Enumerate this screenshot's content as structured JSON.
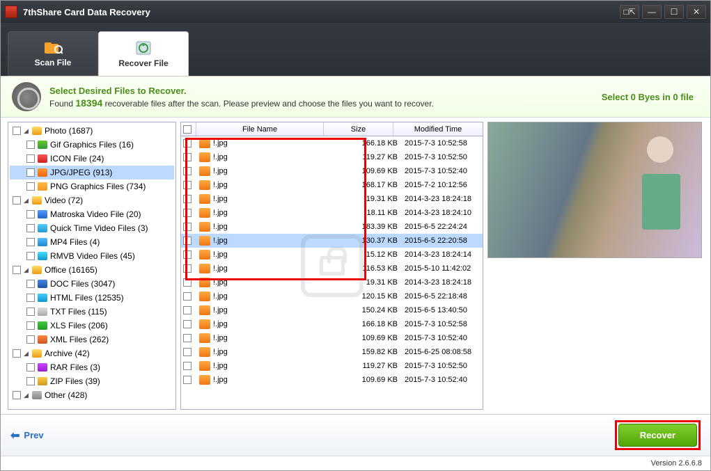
{
  "title": "7thShare Card Data Recovery",
  "tabs": {
    "scan": "Scan File",
    "recover": "Recover File"
  },
  "banner": {
    "title": "Select Desired Files to Recover.",
    "found_prefix": "Found ",
    "found_count": "18394",
    "found_suffix": " recoverable files after the scan. Please preview and choose the files you want to recover.",
    "select_status": "Select 0 Byes in 0 file"
  },
  "tree": {
    "groups": [
      {
        "label": "Photo (1687)",
        "icon": "fi-folder",
        "items": [
          {
            "label": "Gif Graphics Files (16)",
            "icon": "fi-gif"
          },
          {
            "label": "ICON File (24)",
            "icon": "fi-icon"
          },
          {
            "label": "JPG/JPEG (913)",
            "icon": "fi-jpg",
            "selected": true
          },
          {
            "label": "PNG Graphics Files (734)",
            "icon": "fi-png"
          }
        ]
      },
      {
        "label": "Video (72)",
        "icon": "fi-folder",
        "items": [
          {
            "label": "Matroska Video File (20)",
            "icon": "fi-mkv"
          },
          {
            "label": "Quick Time Video Files (3)",
            "icon": "fi-mov"
          },
          {
            "label": "MP4 Files (4)",
            "icon": "fi-mp4"
          },
          {
            "label": "RMVB Video Files (45)",
            "icon": "fi-rmvb"
          }
        ]
      },
      {
        "label": "Office (16165)",
        "icon": "fi-folder",
        "items": [
          {
            "label": "DOC Files (3047)",
            "icon": "fi-doc"
          },
          {
            "label": "HTML Files (12535)",
            "icon": "fi-html"
          },
          {
            "label": "TXT Files (115)",
            "icon": "fi-txt"
          },
          {
            "label": "XLS Files (206)",
            "icon": "fi-xls"
          },
          {
            "label": "XML Files (262)",
            "icon": "fi-xml"
          }
        ]
      },
      {
        "label": "Archive (42)",
        "icon": "fi-folder",
        "items": [
          {
            "label": "RAR Files (3)",
            "icon": "fi-rar"
          },
          {
            "label": "ZIP Files (39)",
            "icon": "fi-zip"
          }
        ]
      },
      {
        "label": "Other (428)",
        "icon": "fi-other",
        "items": []
      }
    ]
  },
  "file_headers": {
    "name": "File Name",
    "size": "Size",
    "time": "Modified Time"
  },
  "files": [
    {
      "name": "!.jpg",
      "size": "166.18 KB",
      "time": "2015-7-3 10:52:58"
    },
    {
      "name": "!.jpg",
      "size": "119.27 KB",
      "time": "2015-7-3 10:52:50"
    },
    {
      "name": "!.jpg",
      "size": "109.69 KB",
      "time": "2015-7-3 10:52:40"
    },
    {
      "name": "!.jpg",
      "size": "168.17 KB",
      "time": "2015-7-2 10:12:56"
    },
    {
      "name": "!.jpg",
      "size": "19.31 KB",
      "time": "2014-3-23 18:24:18"
    },
    {
      "name": "!.jpg",
      "size": "18.11 KB",
      "time": "2014-3-23 18:24:10"
    },
    {
      "name": "!.jpg",
      "size": "183.39 KB",
      "time": "2015-6-5 22:24:24"
    },
    {
      "name": "!.jpg",
      "size": "130.37 KB",
      "time": "2015-6-5 22:20:58",
      "selected": true
    },
    {
      "name": "!.jpg",
      "size": "15.12 KB",
      "time": "2014-3-23 18:24:14"
    },
    {
      "name": "!.jpg",
      "size": "116.53 KB",
      "time": "2015-5-10 11:42:02"
    },
    {
      "name": "!.jpg",
      "size": "19.31 KB",
      "time": "2014-3-23 18:24:18"
    },
    {
      "name": "!.jpg",
      "size": "120.15 KB",
      "time": "2015-6-5 22:18:48"
    },
    {
      "name": "!.jpg",
      "size": "150.24 KB",
      "time": "2015-6-5 13:40:50"
    },
    {
      "name": "!.jpg",
      "size": "166.18 KB",
      "time": "2015-7-3 10:52:58"
    },
    {
      "name": "!.jpg",
      "size": "109.69 KB",
      "time": "2015-7-3 10:52:40"
    },
    {
      "name": "!.jpg",
      "size": "159.82 KB",
      "time": "2015-6-25 08:08:58"
    },
    {
      "name": "!.jpg",
      "size": "119.27 KB",
      "time": "2015-7-3 10:52:50"
    },
    {
      "name": "!.jpg",
      "size": "109.69 KB",
      "time": "2015-7-3 10:52:40"
    }
  ],
  "footer": {
    "prev": "Prev",
    "recover": "Recover"
  },
  "version": "Version 2.6.6.8"
}
